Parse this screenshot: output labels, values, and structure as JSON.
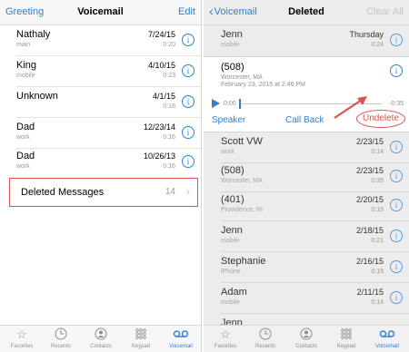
{
  "left": {
    "nav": {
      "left": "Greeting",
      "title": "Voicemail",
      "right": "Edit"
    },
    "rows": [
      {
        "name": "Nathaly",
        "sub": "main",
        "date": "7/24/15",
        "duration": "0:20"
      },
      {
        "name": "King",
        "sub": "mobile",
        "date": "4/10/15",
        "duration": "0:23"
      },
      {
        "name": "Unknown",
        "sub": "",
        "date": "4/1/15",
        "duration": "0:18"
      },
      {
        "name": "Dad",
        "sub": "work",
        "date": "12/23/14",
        "duration": "0:16"
      },
      {
        "name": "Dad",
        "sub": "work",
        "date": "10/26/13",
        "duration": "0:16"
      }
    ],
    "deleted": {
      "label": "Deleted Messages",
      "count": "14"
    },
    "tabs": [
      {
        "label": "Favorites",
        "icon": "☆"
      },
      {
        "label": "Recents",
        "icon": "clock"
      },
      {
        "label": "Contacts",
        "icon": "person"
      },
      {
        "label": "Keypad",
        "icon": "keypad"
      },
      {
        "label": "Voicemail",
        "icon": "voicemail"
      }
    ]
  },
  "right": {
    "nav": {
      "back": "Voicemail",
      "title": "Deleted",
      "right": "Clear All"
    },
    "top_row": {
      "name": "Jenn",
      "sub": "mobile",
      "date": "Thursday",
      "duration": "0:24"
    },
    "expanded": {
      "name": "(508)",
      "sub1": "Worcester, MA",
      "sub2": "February 23, 2015 at 2:46 PM",
      "time_start": "0:00",
      "time_end": "-0:35",
      "speaker": "Speaker",
      "callback": "Call Back",
      "undelete": "Undelete"
    },
    "rows": [
      {
        "name": "Scott VW",
        "sub": "work",
        "date": "2/23/15",
        "duration": "0:14"
      },
      {
        "name": "(508)",
        "sub": "Worcester, MA",
        "date": "2/23/15",
        "duration": "0:35"
      },
      {
        "name": "(401)",
        "sub": "Providence, RI",
        "date": "2/20/15",
        "duration": "0:15"
      },
      {
        "name": "Jenn",
        "sub": "mobile",
        "date": "2/18/15",
        "duration": "0:21"
      },
      {
        "name": "Stephanie",
        "sub": "iPhone",
        "date": "2/16/15",
        "duration": "0:19"
      },
      {
        "name": "Adam",
        "sub": "mobile",
        "date": "2/11/15",
        "duration": "0:14"
      },
      {
        "name": "Jenn",
        "sub": "",
        "date": "",
        "duration": ""
      }
    ],
    "tabs": [
      {
        "label": "Favorites"
      },
      {
        "label": "Recents"
      },
      {
        "label": "Contacts"
      },
      {
        "label": "Keypad"
      },
      {
        "label": "Voicemail"
      }
    ]
  },
  "colors": {
    "accent": "#2f7fd1",
    "highlight": "#d9534f"
  }
}
